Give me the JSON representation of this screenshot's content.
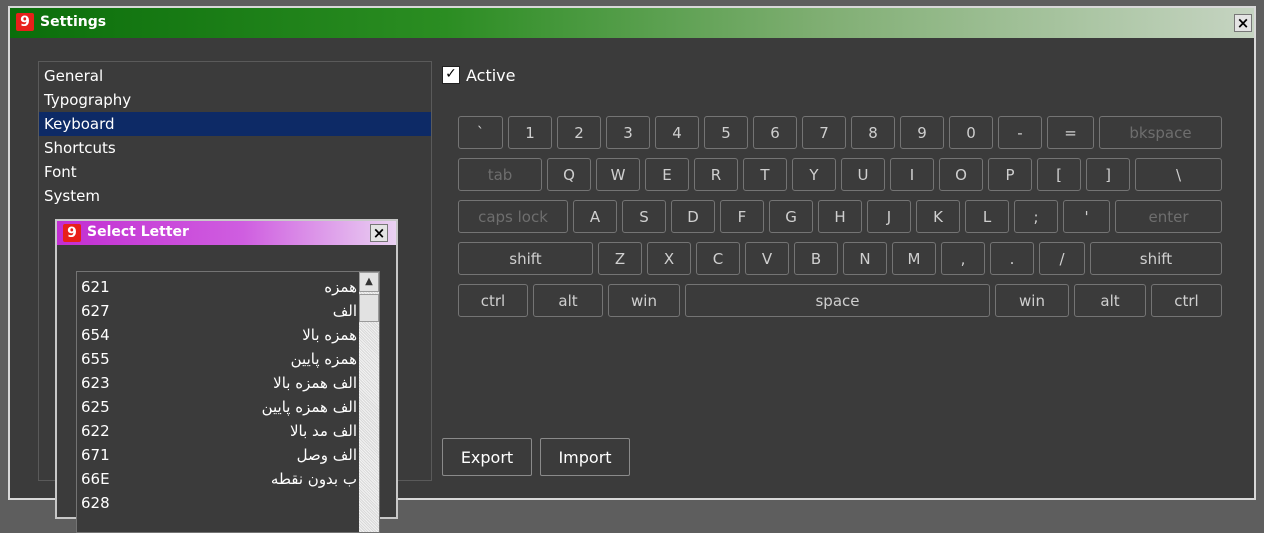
{
  "window": {
    "title": "Settings",
    "logo_glyph": "9",
    "close_glyph": "×"
  },
  "nav": {
    "items": [
      {
        "label": "General"
      },
      {
        "label": "Typography"
      },
      {
        "label": "Keyboard"
      },
      {
        "label": "Shortcuts"
      },
      {
        "label": "Font"
      },
      {
        "label": "System"
      }
    ],
    "selected": "Keyboard"
  },
  "active": {
    "label": "Active",
    "checked": true,
    "check_glyph": "✓"
  },
  "keyboard": {
    "rows": [
      [
        "`",
        "1",
        "2",
        "3",
        "4",
        "5",
        "6",
        "7",
        "8",
        "9",
        "0",
        "-",
        "=",
        "bkspace"
      ],
      [
        "tab",
        "Q",
        "W",
        "E",
        "R",
        "T",
        "Y",
        "U",
        "I",
        "O",
        "P",
        "[",
        "]",
        "\\"
      ],
      [
        "caps lock",
        "A",
        "S",
        "D",
        "F",
        "G",
        "H",
        "J",
        "K",
        "L",
        ";",
        "'",
        "enter"
      ],
      [
        "shift",
        "Z",
        "X",
        "C",
        "V",
        "B",
        "N",
        "M",
        ",",
        ".",
        "/",
        "shift"
      ],
      [
        "ctrl",
        "alt",
        "win",
        "space",
        "win",
        "alt",
        "ctrl"
      ]
    ],
    "dim_keys": [
      "bkspace",
      "tab",
      "caps lock",
      "enter"
    ]
  },
  "buttons": {
    "export": "Export",
    "import": "Import"
  },
  "dialog": {
    "title": "Select Letter",
    "logo_glyph": "9",
    "close_glyph": "×",
    "letters": [
      {
        "code": "621",
        "name": "همزه"
      },
      {
        "code": "627",
        "name": "الف"
      },
      {
        "code": "654",
        "name": "همزه بالا"
      },
      {
        "code": "655",
        "name": "همزه پایین"
      },
      {
        "code": "623",
        "name": "الف همزه بالا"
      },
      {
        "code": "625",
        "name": "الف همزه پایین"
      },
      {
        "code": "622",
        "name": "الف مد بالا"
      },
      {
        "code": "671",
        "name": "الف وصل"
      },
      {
        "code": "66E",
        "name": "ب بدون نقطه"
      },
      {
        "code": "628",
        "name": ""
      }
    ]
  }
}
